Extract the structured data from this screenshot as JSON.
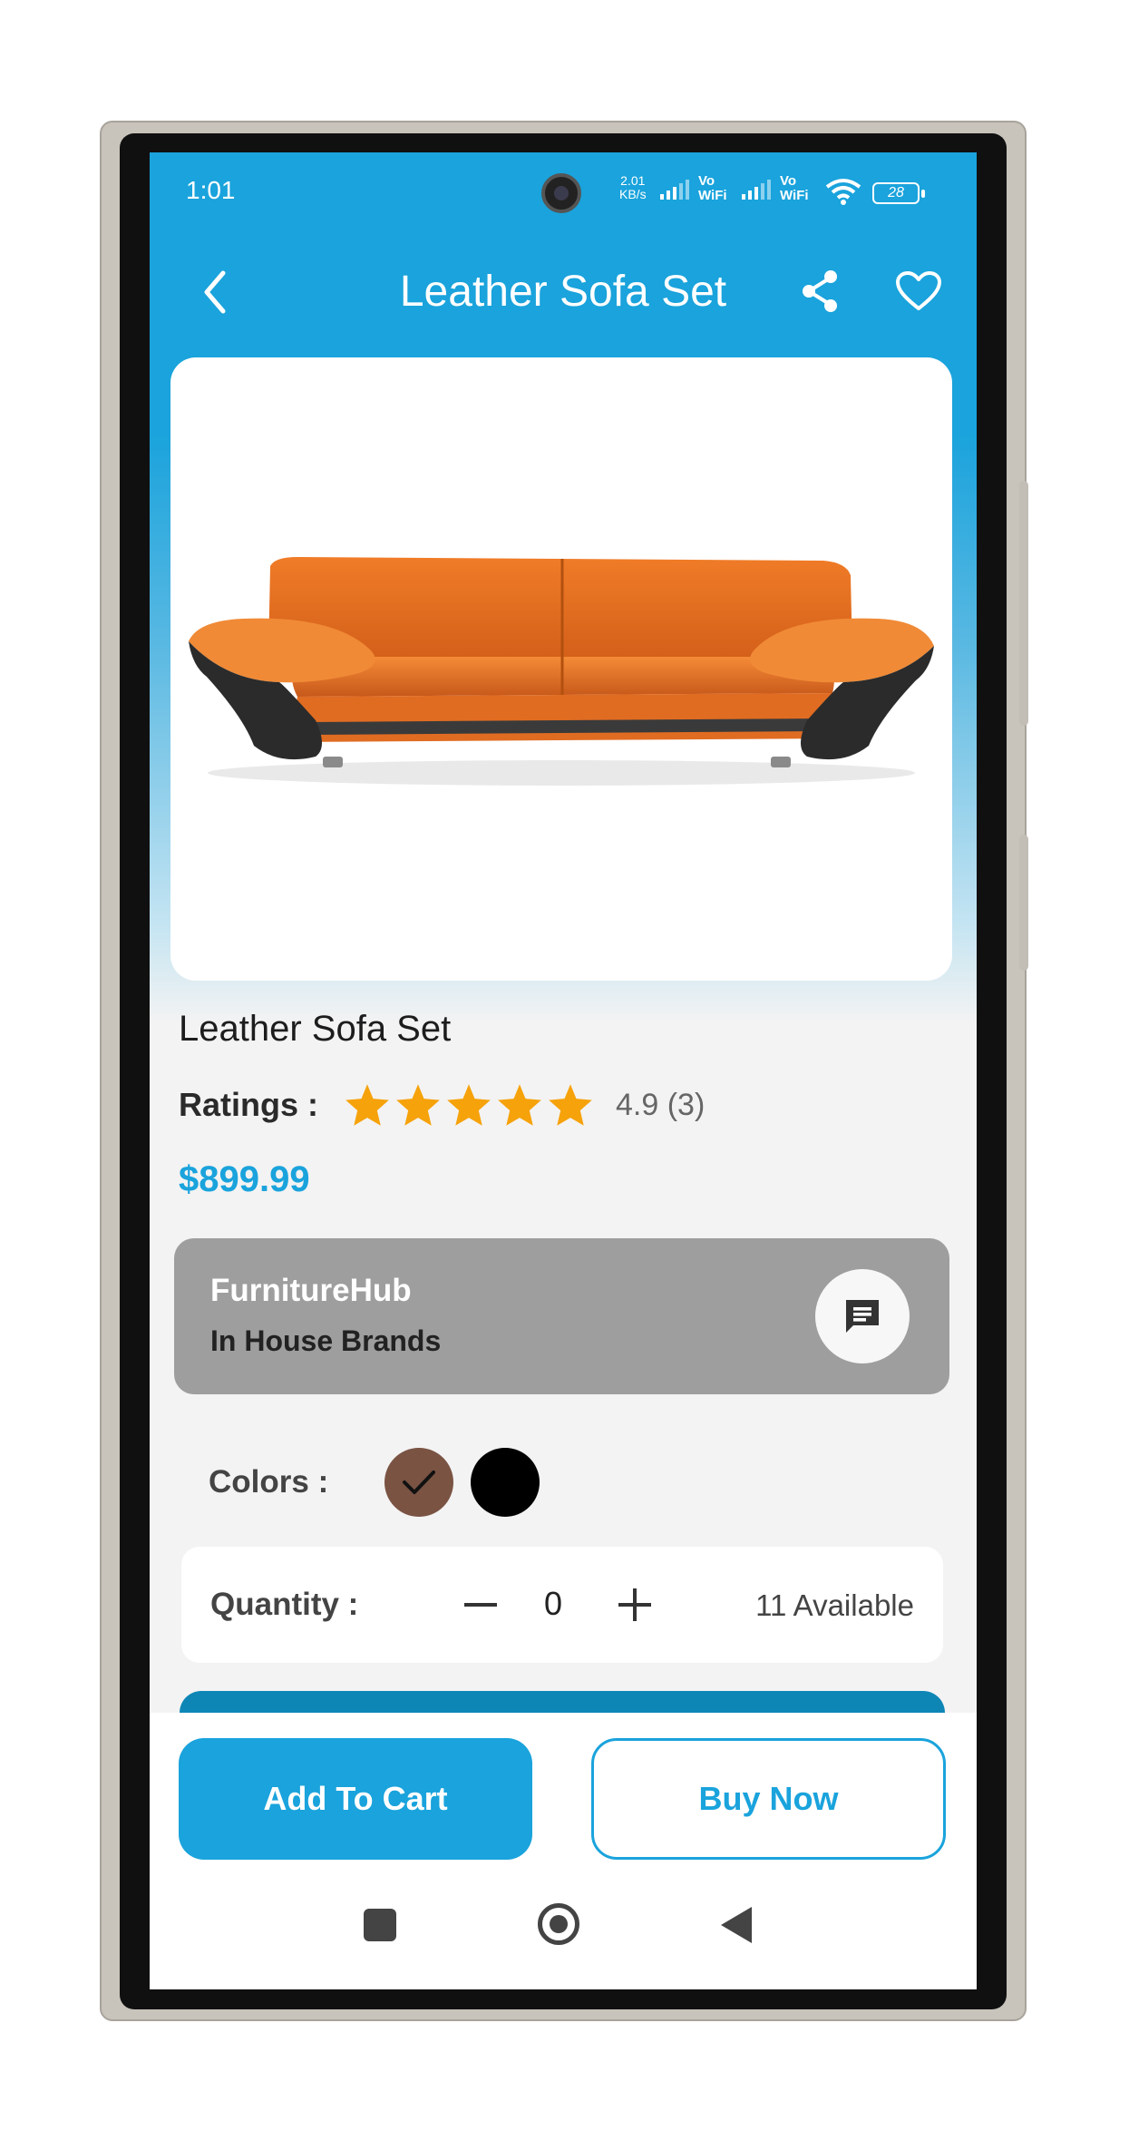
{
  "status_bar": {
    "time": "1:01",
    "net_speed_value": "2.01",
    "net_speed_unit": "KB/s",
    "sim1": "Vo WiFi",
    "sim2": "Vo WiFi",
    "battery": "28"
  },
  "app_bar": {
    "title": "Leather Sofa Set",
    "back_icon": "chevron-left-icon",
    "share_icon": "share-icon",
    "favorite_icon": "heart-outline-icon"
  },
  "product": {
    "image_alt": "orange leather sofa",
    "name": "Leather Sofa Set",
    "ratings_label": "Ratings :",
    "rating": 4.9,
    "rating_text": "4.9 (3)",
    "stars_filled": 5,
    "price": "$899.99"
  },
  "seller": {
    "name": "FurnitureHub",
    "type": "In House Brands",
    "chat_icon": "chat-icon"
  },
  "colors": {
    "label": "Colors :",
    "options": [
      {
        "color": "#7a5343",
        "selected": true
      },
      {
        "color": "#000000",
        "selected": false
      }
    ]
  },
  "quantity": {
    "label": "Quantity :",
    "value": "0",
    "available": "11 Available"
  },
  "actions": {
    "add_to_cart": "Add To Cart",
    "buy_now": "Buy Now"
  },
  "theme": {
    "primary": "#1aa3dc",
    "star": "#f6a20b",
    "seller_bg": "#9e9e9e"
  }
}
